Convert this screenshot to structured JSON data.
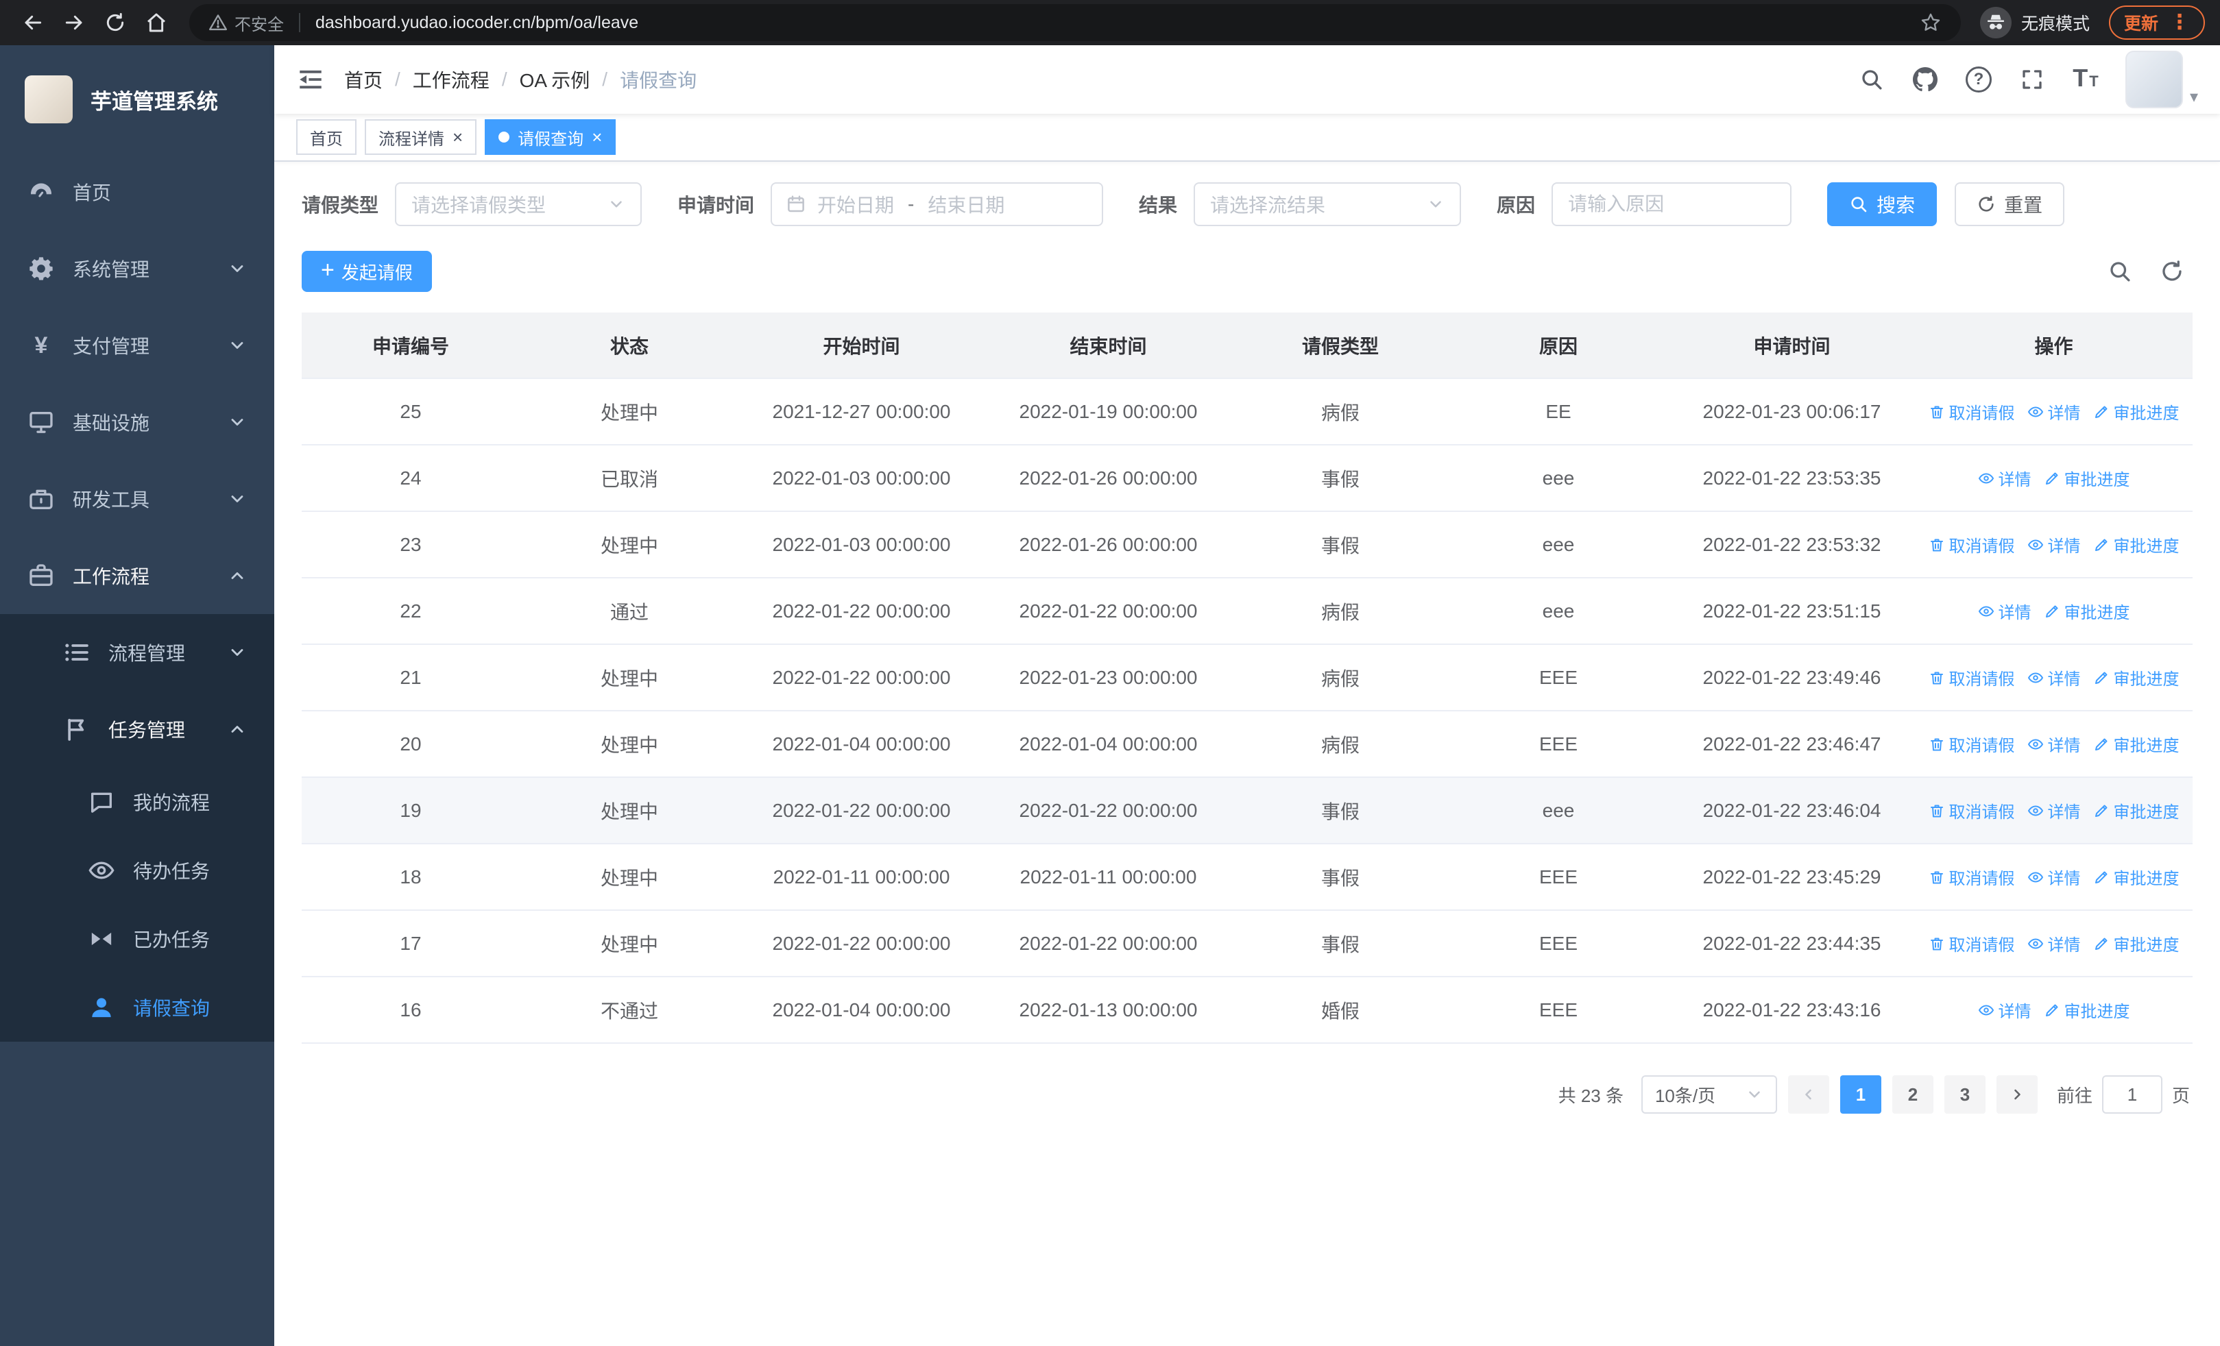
{
  "browser": {
    "url": "dashboard.yudao.iocoder.cn/bpm/oa/leave",
    "security_warning": "不安全",
    "incognito_label": "无痕模式",
    "update_label": "更新"
  },
  "sidebar": {
    "title": "芋道管理系统",
    "menu": [
      {
        "key": "home",
        "label": "首页",
        "icon": "dashboard-icon",
        "arrow": "",
        "state": ""
      },
      {
        "key": "system",
        "label": "系统管理",
        "icon": "gear-icon",
        "arrow": "down",
        "state": ""
      },
      {
        "key": "payment",
        "label": "支付管理",
        "icon": "payment-icon",
        "arrow": "down",
        "state": ""
      },
      {
        "key": "infrastructure",
        "label": "基础设施",
        "icon": "infrastructure-icon",
        "arrow": "down",
        "state": ""
      },
      {
        "key": "devtools",
        "label": "研发工具",
        "icon": "devtools-icon",
        "arrow": "down",
        "state": ""
      },
      {
        "key": "workflow",
        "label": "工作流程",
        "icon": "workflow-icon",
        "arrow": "up",
        "state": "open"
      }
    ],
    "submenu": [
      {
        "key": "process-mgmt",
        "label": "流程管理",
        "icon": "process-mgmt-icon",
        "arrow": "down",
        "state": ""
      },
      {
        "key": "task-mgmt",
        "label": "任务管理",
        "icon": "task-mgmt-icon",
        "arrow": "up",
        "state": "open"
      }
    ],
    "task_items": [
      {
        "key": "my-process",
        "label": "我的流程",
        "icon": "my-process-icon",
        "state": ""
      },
      {
        "key": "todo-tasks",
        "label": "待办任务",
        "icon": "todo-tasks-icon",
        "state": ""
      },
      {
        "key": "done-tasks",
        "label": "已办任务",
        "icon": "done-tasks-icon",
        "state": ""
      },
      {
        "key": "leave-query",
        "label": "请假查询",
        "icon": "leave-query-icon",
        "state": "active"
      }
    ]
  },
  "navbar": {
    "breadcrumb": [
      "首页",
      "工作流程",
      "OA 示例",
      "请假查询"
    ]
  },
  "tabs": [
    {
      "key": "home",
      "label": "首页",
      "closable": false,
      "active": false
    },
    {
      "key": "process-detail",
      "label": "流程详情",
      "closable": true,
      "active": false
    },
    {
      "key": "leave-query",
      "label": "请假查询",
      "closable": true,
      "active": true
    }
  ],
  "filters": {
    "leave_type_label": "请假类型",
    "leave_type_placeholder": "请选择请假类型",
    "apply_time_label": "申请时间",
    "date_start_placeholder": "开始日期",
    "date_separator": "-",
    "date_end_placeholder": "结束日期",
    "result_label": "结果",
    "result_placeholder": "请选择流结果",
    "reason_label": "原因",
    "reason_placeholder": "请输入原因",
    "search_button": "搜索",
    "reset_button": "重置"
  },
  "toolbar": {
    "create_button": "发起请假"
  },
  "table": {
    "columns": [
      "申请编号",
      "状态",
      "开始时间",
      "结束时间",
      "请假类型",
      "原因",
      "申请时间",
      "操作"
    ],
    "action_labels": {
      "cancel": "取消请假",
      "detail": "详情",
      "progress": "审批进度"
    },
    "rows": [
      {
        "id": "25",
        "status": "处理中",
        "start": "2021-12-27 00:00:00",
        "end": "2022-01-19 00:00:00",
        "type": "病假",
        "reason": "EE",
        "applied": "2022-01-23 00:06:17",
        "actions": [
          "cancel",
          "detail",
          "progress"
        ],
        "highlight": false
      },
      {
        "id": "24",
        "status": "已取消",
        "start": "2022-01-03 00:00:00",
        "end": "2022-01-26 00:00:00",
        "type": "事假",
        "reason": "eee",
        "applied": "2022-01-22 23:53:35",
        "actions": [
          "detail",
          "progress"
        ],
        "highlight": false
      },
      {
        "id": "23",
        "status": "处理中",
        "start": "2022-01-03 00:00:00",
        "end": "2022-01-26 00:00:00",
        "type": "事假",
        "reason": "eee",
        "applied": "2022-01-22 23:53:32",
        "actions": [
          "cancel",
          "detail",
          "progress"
        ],
        "highlight": false
      },
      {
        "id": "22",
        "status": "通过",
        "start": "2022-01-22 00:00:00",
        "end": "2022-01-22 00:00:00",
        "type": "病假",
        "reason": "eee",
        "applied": "2022-01-22 23:51:15",
        "actions": [
          "detail",
          "progress"
        ],
        "highlight": false
      },
      {
        "id": "21",
        "status": "处理中",
        "start": "2022-01-22 00:00:00",
        "end": "2022-01-23 00:00:00",
        "type": "病假",
        "reason": "EEE",
        "applied": "2022-01-22 23:49:46",
        "actions": [
          "cancel",
          "detail",
          "progress"
        ],
        "highlight": false
      },
      {
        "id": "20",
        "status": "处理中",
        "start": "2022-01-04 00:00:00",
        "end": "2022-01-04 00:00:00",
        "type": "病假",
        "reason": "EEE",
        "applied": "2022-01-22 23:46:47",
        "actions": [
          "cancel",
          "detail",
          "progress"
        ],
        "highlight": false
      },
      {
        "id": "19",
        "status": "处理中",
        "start": "2022-01-22 00:00:00",
        "end": "2022-01-22 00:00:00",
        "type": "事假",
        "reason": "eee",
        "applied": "2022-01-22 23:46:04",
        "actions": [
          "cancel",
          "detail",
          "progress"
        ],
        "highlight": true
      },
      {
        "id": "18",
        "status": "处理中",
        "start": "2022-01-11 00:00:00",
        "end": "2022-01-11 00:00:00",
        "type": "事假",
        "reason": "EEE",
        "applied": "2022-01-22 23:45:29",
        "actions": [
          "cancel",
          "detail",
          "progress"
        ],
        "highlight": false
      },
      {
        "id": "17",
        "status": "处理中",
        "start": "2022-01-22 00:00:00",
        "end": "2022-01-22 00:00:00",
        "type": "事假",
        "reason": "EEE",
        "applied": "2022-01-22 23:44:35",
        "actions": [
          "cancel",
          "detail",
          "progress"
        ],
        "highlight": false
      },
      {
        "id": "16",
        "status": "不通过",
        "start": "2022-01-04 00:00:00",
        "end": "2022-01-13 00:00:00",
        "type": "婚假",
        "reason": "EEE",
        "applied": "2022-01-22 23:43:16",
        "actions": [
          "detail",
          "progress"
        ],
        "highlight": false
      }
    ]
  },
  "pagination": {
    "total_text": "共 23 条",
    "page_size": "10条/页",
    "pages": [
      "1",
      "2",
      "3"
    ],
    "active_page": "1",
    "goto_label": "前往",
    "goto_value": "1",
    "goto_suffix": "页"
  },
  "colors": {
    "primary": "#409eff",
    "sidebar_bg": "#304156",
    "sidebar_sub_bg": "#1f2d3d",
    "sidebar_text": "#bfcbd9"
  }
}
